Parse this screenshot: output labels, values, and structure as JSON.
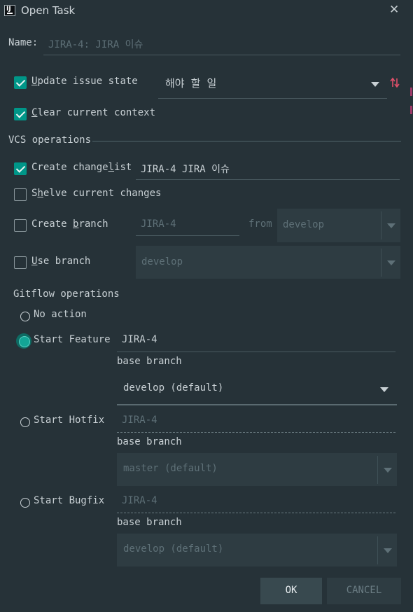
{
  "window": {
    "title": "Open Task",
    "icon": "intellij-app-icon",
    "icon_text": "IJ",
    "close_glyph": "✕"
  },
  "name_field": {
    "label": "Name:",
    "placeholder": "JIRA-4: JIRA 이슈"
  },
  "update_issue_state": {
    "label_prefix": "",
    "mnemonic": "U",
    "label_rest": "pdate issue state",
    "checked": true,
    "value": "해야 할 일",
    "sort_icon": "sort-arrows-icon"
  },
  "clear_context": {
    "mnemonic": "C",
    "label_rest": "lear current context",
    "checked": true
  },
  "vcs_section": {
    "title": "VCS operations"
  },
  "create_changelist": {
    "label_prefix": "Create change",
    "mnemonic": "l",
    "label_rest": "ist",
    "checked": true,
    "value": "JIRA-4 JIRA 이슈"
  },
  "shelve_changes": {
    "label_prefix": "S",
    "mnemonic": "h",
    "label_rest": "elve current changes",
    "checked": false
  },
  "create_branch": {
    "label_prefix": "Create ",
    "mnemonic": "b",
    "label_rest": "ranch",
    "checked": false,
    "branch_placeholder": "JIRA-4",
    "from_label": "from",
    "from_value": "develop"
  },
  "use_branch": {
    "label_prefix": "",
    "mnemonic": "U",
    "label_rest": "se branch",
    "checked": false,
    "value": "develop"
  },
  "gitflow": {
    "title": "Gitflow operations",
    "no_action": {
      "label": "No action",
      "selected": false
    },
    "start_feature": {
      "label": "Start Feature",
      "selected": true,
      "name_value": "JIRA-4",
      "base_branch_label": "base branch",
      "base_branch_value": "develop (default)"
    },
    "start_hotfix": {
      "label": "Start Hotfix",
      "selected": false,
      "name_placeholder": "JIRA-4",
      "base_branch_label": "base branch",
      "base_branch_value": "master (default)"
    },
    "start_bugfix": {
      "label": "Start Bugfix",
      "selected": false,
      "name_placeholder": "JIRA-4",
      "base_branch_label": "base branch",
      "base_branch_value": "develop (default)"
    }
  },
  "buttons": {
    "ok": "OK",
    "cancel": "CANCEL"
  },
  "colors": {
    "background": "#263238",
    "accent": "#009688",
    "text": "#c8d0d4",
    "muted": "#5e7077"
  }
}
